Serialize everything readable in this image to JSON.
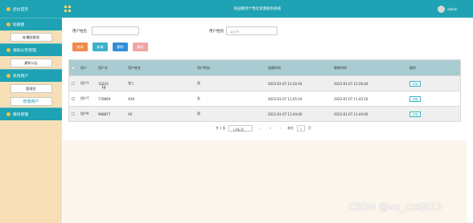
{
  "header": {
    "title": "校园教师个性化资源服务系统",
    "username": "admin"
  },
  "sidebar": {
    "brand": "后台首页",
    "groups": [
      {
        "label": "轮播图",
        "items": [
          {
            "label": "轮播图管理"
          }
        ]
      },
      {
        "label": "通知公告管理",
        "items": [
          {
            "label": "通知公告"
          }
        ]
      },
      {
        "label": "系统用户",
        "items": [
          {
            "label": "管理员"
          },
          {
            "label": "普通用户",
            "active": true
          }
        ]
      },
      {
        "label": "模块管理",
        "items": []
      }
    ]
  },
  "search": {
    "username_label": "用户姓名",
    "gender_label": "用户性别",
    "gender_placeholder": "请选择",
    "chevron": "⌄"
  },
  "toolbar": {
    "search_label": "查询",
    "add_label": "新增",
    "delete_label": "删除",
    "batch_label": "删除"
  },
  "table": {
    "headers": [
      "用户",
      "用户名",
      "用户姓名",
      "用户性别",
      "创建时间",
      "更新时间",
      "操作"
    ],
    "rows": [
      {
        "type": "用户1",
        "account": "11233",
        "name": "张三",
        "gender": "男",
        "created": "2023-01-07 12:20:44",
        "updated": "2023-01-07 12:20:44",
        "action": "详情"
      },
      {
        "type": "用户7",
        "account": "778899",
        "name": "XXX",
        "gender": "女",
        "created": "2023-01-07 11:45:16",
        "updated": "2023-01-07 11:45:16",
        "action": "详情"
      },
      {
        "type": "用户6",
        "account": "998877",
        "name": "XX",
        "gender": "男",
        "created": "2023-01-07 11:44:06",
        "updated": "2023-01-07 11:44:06",
        "action": "详情"
      }
    ]
  },
  "pagination": {
    "total": "共 3 条",
    "page_size": "10条/页",
    "prev": "‹",
    "current": "1",
    "next": "›",
    "goto_label": "前往",
    "goto_value": "1",
    "page_suffix": "页"
  },
  "watermark": "CSDN @vx_cxsj813"
}
